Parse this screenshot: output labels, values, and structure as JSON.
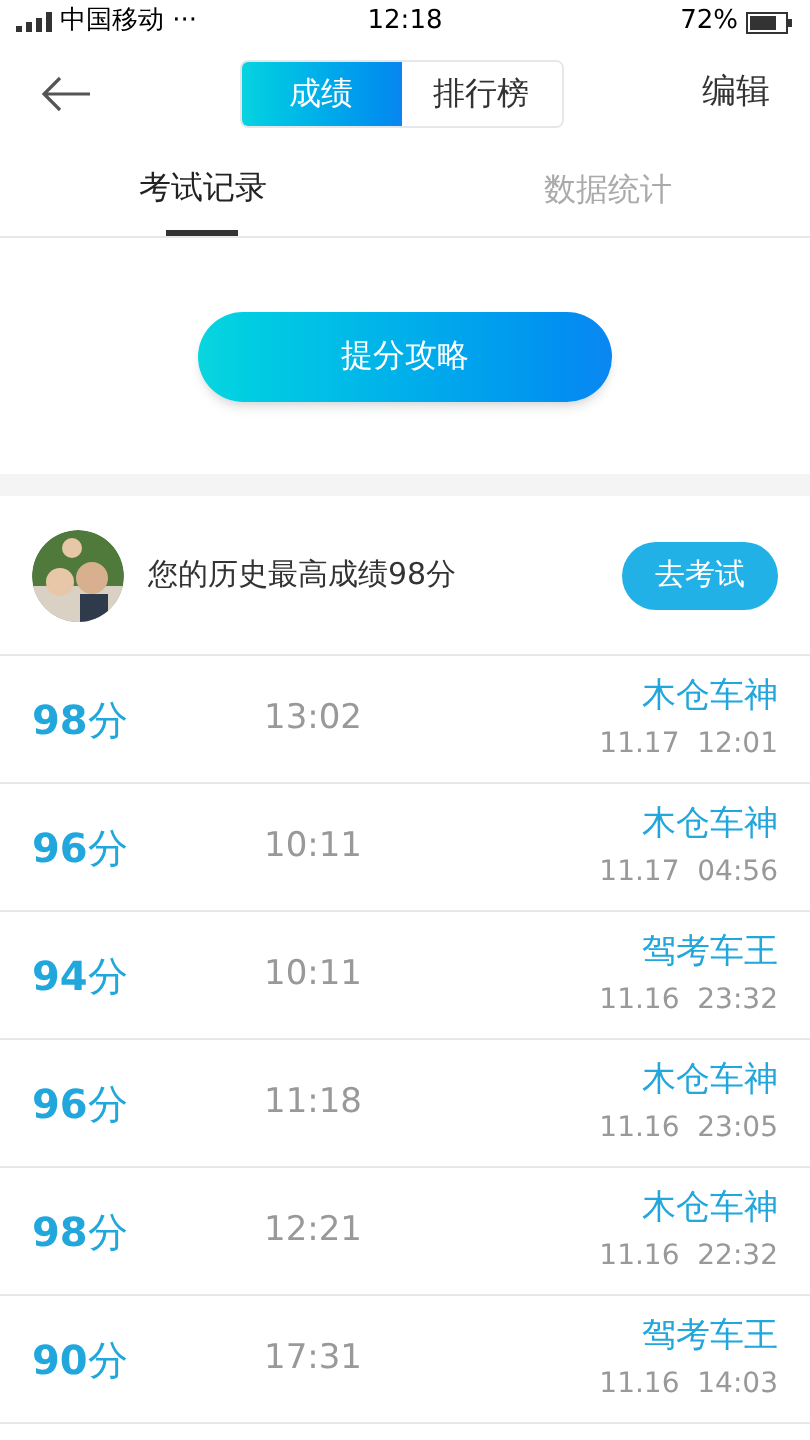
{
  "status_bar": {
    "carrier": "中国移动 ···",
    "time": "12:18",
    "battery": "72%"
  },
  "nav": {
    "segments": [
      {
        "label": "成绩",
        "selected": true
      },
      {
        "label": "排行榜",
        "selected": false
      }
    ],
    "action": "编辑"
  },
  "tabs": [
    {
      "label": "考试记录",
      "selected": true
    },
    {
      "label": "数据统计",
      "selected": false
    }
  ],
  "tips_button": "提分攻略",
  "best": {
    "text": "您的历史最高成绩98分",
    "button": "去考试"
  },
  "records": [
    {
      "score": "**98**分",
      "duration": "13:02",
      "title": "木仓车神",
      "date": "11.17  12:01"
    },
    {
      "score": "**96**分",
      "duration": "10:11",
      "title": "木仓车神",
      "date": "11.17  04:56"
    },
    {
      "score": "**94**分",
      "duration": "10:11",
      "title": "驾考车王",
      "date": "11.16  23:32"
    },
    {
      "score": "**96**分",
      "duration": "11:18",
      "title": "木仓车神",
      "date": "11.16  23:05"
    },
    {
      "score": "**98**分",
      "duration": "12:21",
      "title": "木仓车神",
      "date": "11.16  22:32"
    },
    {
      "score": "**90**分",
      "duration": "17:31",
      "title": "驾考车王",
      "date": "11.16  14:03"
    }
  ]
}
